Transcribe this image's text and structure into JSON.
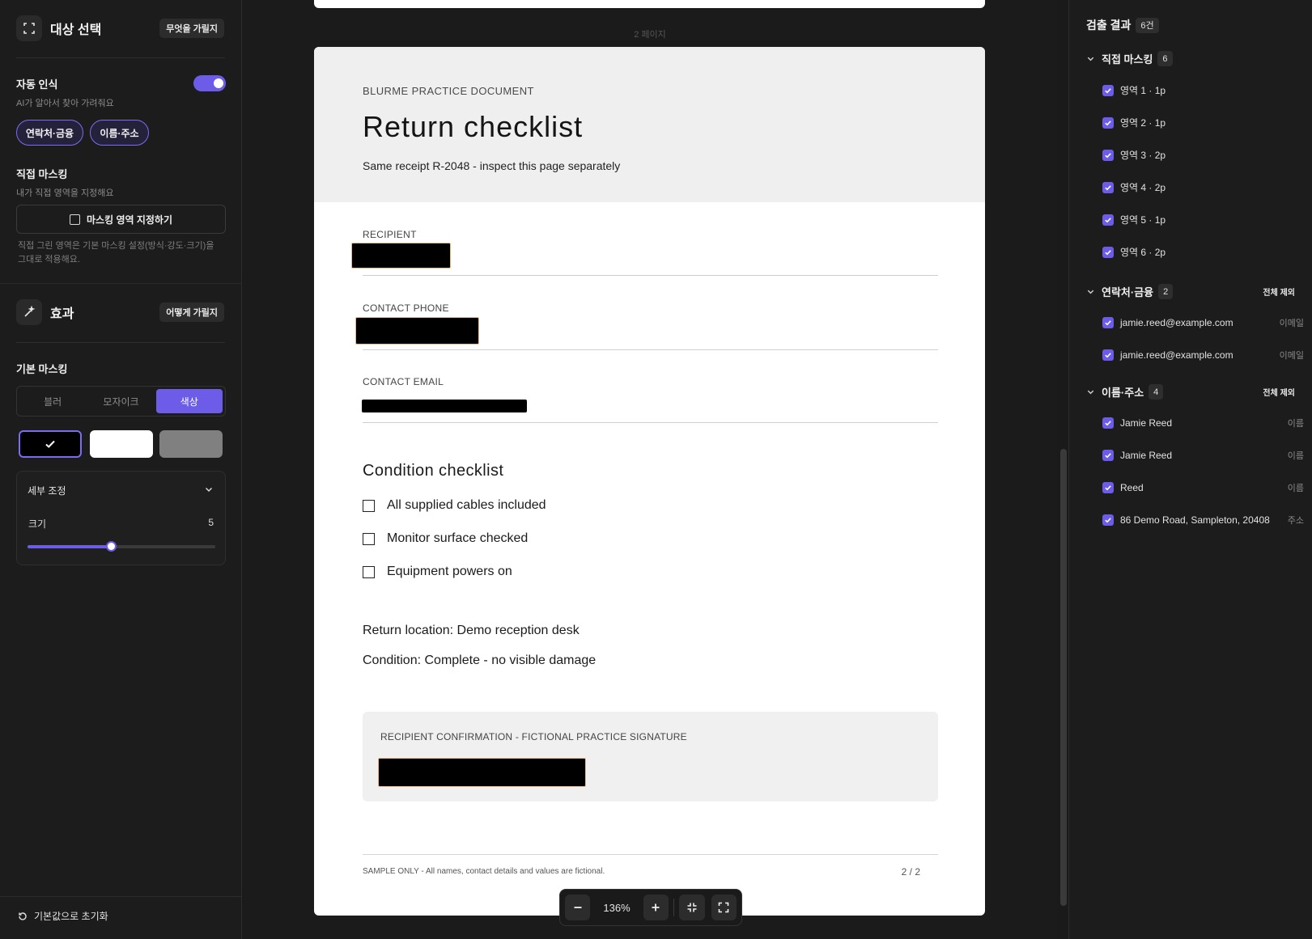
{
  "left": {
    "target": {
      "title": "대상 선택",
      "help_label": "무엇을 가릴지"
    },
    "auto": {
      "label": "자동 인식",
      "desc": "AI가 알아서 찾아 가려줘요",
      "enabled": true,
      "pills": [
        "연락처·금융",
        "이름·주소"
      ]
    },
    "manual": {
      "label": "직접 마스킹",
      "desc": "내가 직접 영역을 지정해요",
      "button": "마스킹 영역 지정하기",
      "note": "직접 그린 영역은 기본 마스킹 설정(방식·강도·크기)을 그대로 적용해요."
    },
    "effect": {
      "title": "효과",
      "help_label": "어떻게 가릴지"
    },
    "basic": {
      "label": "기본 마스킹",
      "modes": [
        "블러",
        "모자이크",
        "색상"
      ],
      "active_mode": "색상",
      "swatches": [
        "#000000",
        "#ffffff",
        "#808080"
      ],
      "selected_swatch": 0
    },
    "detail": {
      "title": "세부 조정",
      "size_label": "크기",
      "size_value": "5",
      "size_fraction": 0.445
    },
    "reset": "기본값으로 초기화"
  },
  "document": {
    "page_label": "2 페이지",
    "kicker": "BLURME PRACTICE DOCUMENT",
    "title": "Return checklist",
    "subtitle": "Same receipt R-2048 - inspect this page separately",
    "fields": {
      "recipient": "RECIPIENT",
      "phone": "CONTACT PHONE",
      "email": "CONTACT EMAIL"
    },
    "checklist_title": "Condition checklist",
    "checklist": [
      "All supplied cables included",
      "Monitor surface checked",
      "Equipment powers on"
    ],
    "return_location": "Return location: Demo reception desk",
    "condition": "Condition: Complete - no visible damage",
    "signature_caption": "RECIPIENT CONFIRMATION - FICTIONAL PRACTICE SIGNATURE",
    "footer_note": "SAMPLE ONLY - All names, contact details and values are fictional.",
    "footer_page": "2 / 2"
  },
  "zoom": {
    "label": "136%"
  },
  "results": {
    "title": "검출 결과",
    "count": "6건",
    "exclude_all": "전체 제외",
    "groups": [
      {
        "name": "직접 마스킹",
        "count": "6",
        "items": [
          {
            "text": "영역 1 · 1p",
            "tag": ""
          },
          {
            "text": "영역 2 · 1p",
            "tag": ""
          },
          {
            "text": "영역 3 · 2p",
            "tag": ""
          },
          {
            "text": "영역 4 · 2p",
            "tag": ""
          },
          {
            "text": "영역 5 · 1p",
            "tag": ""
          },
          {
            "text": "영역 6 · 2p",
            "tag": ""
          }
        ]
      },
      {
        "name": "연락처·금융",
        "count": "2",
        "items": [
          {
            "text": "jamie.reed@example.com",
            "tag": "이메일"
          },
          {
            "text": "jamie.reed@example.com",
            "tag": "이메일"
          }
        ]
      },
      {
        "name": "이름·주소",
        "count": "4",
        "items": [
          {
            "text": "Jamie Reed",
            "tag": "이름"
          },
          {
            "text": "Jamie Reed",
            "tag": "이름"
          },
          {
            "text": "Reed",
            "tag": "이름"
          },
          {
            "text": "86 Demo Road, Sampleton, 20408",
            "tag": "주소"
          }
        ]
      }
    ]
  },
  "colors": {
    "accent": "#6c5ce7",
    "panel": "#1c1c1c",
    "redaction": "#000000"
  }
}
